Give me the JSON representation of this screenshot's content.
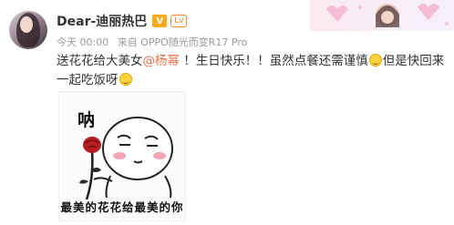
{
  "user": {
    "name": "Dear-迪丽热巴",
    "vip_badge": "V",
    "level_badge": "Lv"
  },
  "meta": {
    "time": "今天 00:00",
    "source": "来自 OPPO随光而变R17 Pro"
  },
  "post": {
    "part1": "送花花给大美女",
    "mention": "@杨幂",
    "part2": " ！生日快乐！！虽然点餐还需谨慎",
    "part3": "但是快回来一起吃饭呀"
  },
  "sticker": {
    "word": "呐",
    "caption": "最美的花花给最美的你"
  },
  "colors": {
    "mention": "#eb7350",
    "vip": "#f8a91c",
    "meta": "#999999"
  }
}
